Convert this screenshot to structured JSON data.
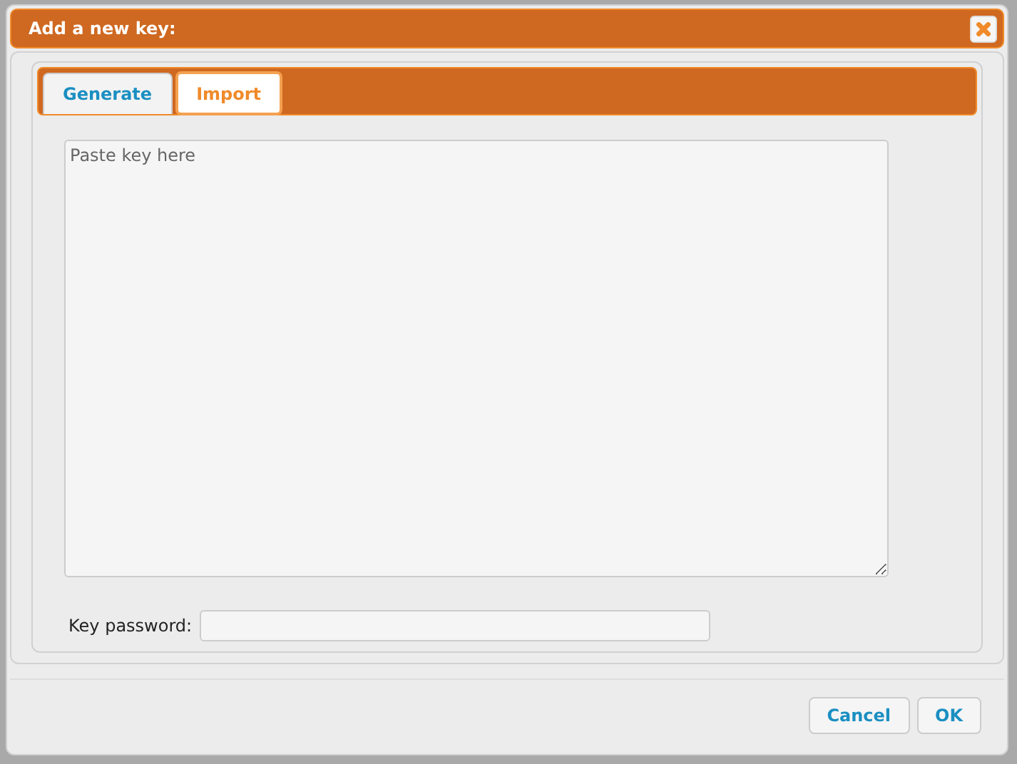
{
  "window": {
    "title": "Add a new key:"
  },
  "tabs": [
    {
      "label": "Generate",
      "selected": false
    },
    {
      "label": "Import",
      "selected": true
    }
  ],
  "key_field": {
    "placeholder": "Paste key here"
  },
  "password": {
    "label": "Key password:"
  },
  "buttons": [
    "Cancel",
    "OK"
  ]
}
